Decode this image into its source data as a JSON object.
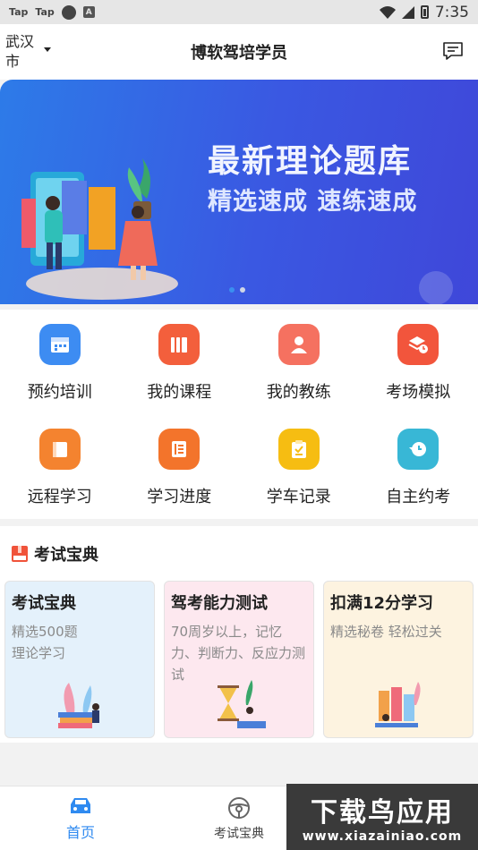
{
  "status_bar": {
    "left": [
      "Tap",
      "Tap"
    ],
    "time": "7:35"
  },
  "header": {
    "city": "武汉市",
    "title": "博软驾培学员",
    "message_icon": "message-icon"
  },
  "banner": {
    "line1": "最新理论题库",
    "line2": "精选速成 速练速成",
    "slides": 2,
    "active_slide": 1
  },
  "grid": [
    {
      "label": "预约培训",
      "icon": "calendar-icon",
      "color": "#3d8cf2"
    },
    {
      "label": "我的课程",
      "icon": "books-icon",
      "color": "#f35f3c"
    },
    {
      "label": "我的教练",
      "icon": "person-icon",
      "color": "#f57160"
    },
    {
      "label": "考场模拟",
      "icon": "layers-clock-icon",
      "color": "#f2553c"
    },
    {
      "label": "远程学习",
      "icon": "book-icon",
      "color": "#f4832f"
    },
    {
      "label": "学习进度",
      "icon": "progress-list-icon",
      "color": "#f3742b"
    },
    {
      "label": "学车记录",
      "icon": "clipboard-icon",
      "color": "#f6bd12"
    },
    {
      "label": "自主约考",
      "icon": "history-icon",
      "color": "#38b7d6"
    }
  ],
  "section": {
    "title": "考试宝典",
    "cards": [
      {
        "title": "考试宝典",
        "desc": "精选500题\n理论学习",
        "bg": "#e4f1fb"
      },
      {
        "title": "驾考能力测试",
        "desc": "70周岁以上，记忆力、判断力、反应力测试",
        "bg": "#fde8ef"
      },
      {
        "title": "扣满12分学习",
        "desc": "精选秘卷 轻松过关",
        "bg": "#fdf3e0"
      }
    ]
  },
  "nav": {
    "items": [
      {
        "label": "首页",
        "icon": "car-icon",
        "active": true
      },
      {
        "label": "考试宝典",
        "icon": "steering-wheel-icon",
        "active": false
      }
    ]
  },
  "watermark": {
    "big": "下载鸟应用",
    "small": "www.xiazainiao.com"
  },
  "colors": {
    "accent": "#2d7be8",
    "banner_start": "#2d7be8",
    "banner_end": "#3f47d9"
  }
}
